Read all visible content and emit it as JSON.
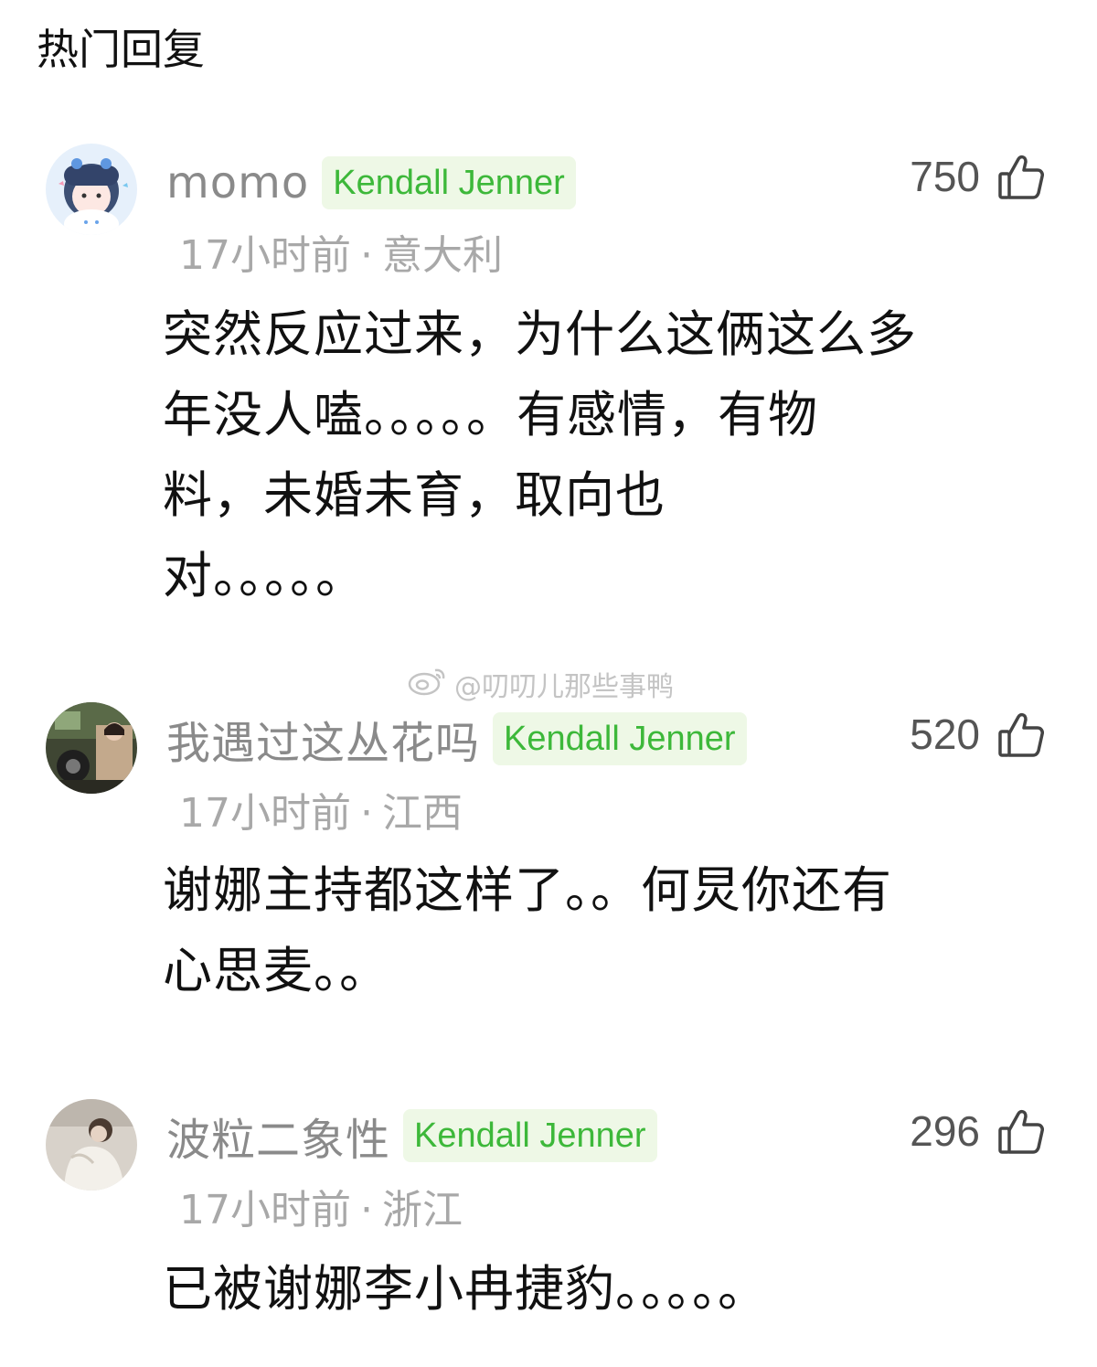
{
  "section_title": "热门回复",
  "watermark": "@叨叨儿那些事鸭",
  "comments": [
    {
      "username": "momo",
      "badge": "Kendall Jenner",
      "likes": "750",
      "time": "17小时前",
      "location": "意大利",
      "separator": "·",
      "lines": [
        "突然反应过来，为什么这俩这么多",
        "年没人嗑。。。。。有感情，有物",
        "料，未婚未育，取向也",
        "对。。。。。"
      ]
    },
    {
      "username": "我遇过这丛花吗",
      "badge": "Kendall Jenner",
      "likes": "520",
      "time": "17小时前",
      "location": "江西",
      "separator": "·",
      "lines": [
        "谢娜主持都这样了。。何炅你还有",
        "心思麦。。"
      ]
    },
    {
      "username": "波粒二象性",
      "badge": "Kendall Jenner",
      "likes": "296",
      "time": "17小时前",
      "location": "浙江",
      "separator": "·",
      "lines": [
        "已被谢娜李小冉捷豹。。。。。"
      ]
    }
  ]
}
